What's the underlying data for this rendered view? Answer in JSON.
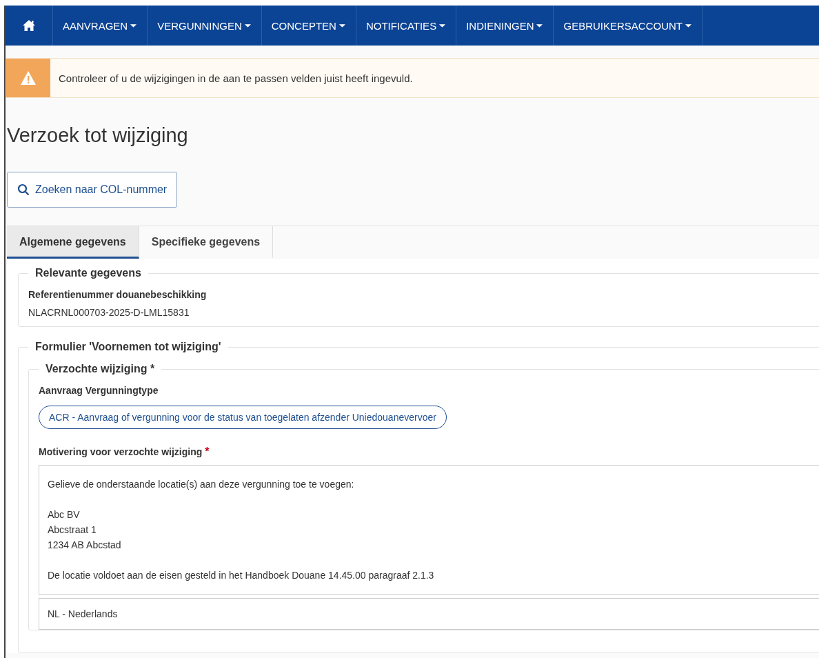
{
  "nav": {
    "items": [
      {
        "label": "AANVRAGEN",
        "caret": "⏷"
      },
      {
        "label": "VERGUNNINGEN",
        "caret": "⏷"
      },
      {
        "label": "CONCEPTEN",
        "caret": "⏷"
      },
      {
        "label": "NOTIFICATIES",
        "caret": "⏷"
      },
      {
        "label": "INDIENINGEN",
        "caret": "⏷"
      },
      {
        "label": "GEBRUIKERSACCOUNT",
        "caret": "⏷"
      }
    ]
  },
  "alert": {
    "kind": "warning",
    "message": "Controleer of u de wijzigingen in de aan te passen velden juist heeft ingevuld."
  },
  "page_title": "Verzoek tot wijziging",
  "search_button": "Zoeken naar COL-nummer",
  "tabs": [
    {
      "label": "Algemene gegevens",
      "selected": true
    },
    {
      "label": "Specifieke gegevens",
      "selected": false
    }
  ],
  "relevant": {
    "legend": "Relevante gegevens",
    "label": "Referentienummer douanebeschikking",
    "value": "NLACRNL000703-2025-D-LML15831"
  },
  "form": {
    "legend": "Formulier 'Voornemen tot wijziging'",
    "requested": {
      "legend": "Verzochte wijziging *",
      "type_label": "Aanvraag Vergunningtype",
      "type_value": "ACR - Aanvraag of vergunning voor de status van toegelaten afzender Uniedouanevervoer",
      "motivation_label": "Motivering voor verzochte wijziging",
      "required_mark": "*",
      "motivation_value": "Gelieve de onderstaande locatie(s) aan deze vergunning toe te voegen:\n\nAbc BV\nAbcstraat 1\n1234 AB Abcstad\n\nDe locatie voldoet aan de eisen gesteld in het Handboek Douane 14.45.00 paragraaf 2.1.3",
      "language": "NL - Nederlands"
    }
  }
}
